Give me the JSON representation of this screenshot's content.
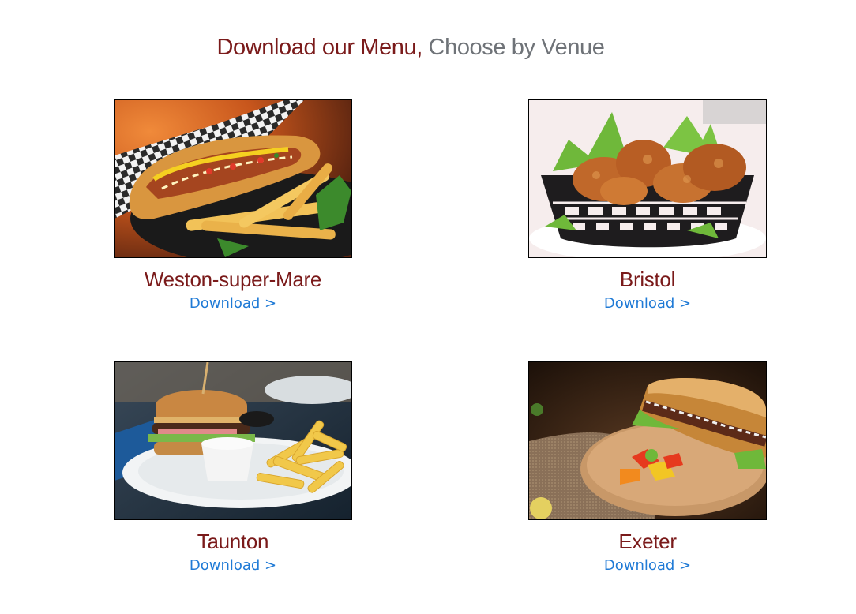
{
  "heading": {
    "part1": "Download our Menu,",
    "part2": "Choose by Venue"
  },
  "venues": [
    {
      "name": "Weston-super-Mare",
      "link": "Download >",
      "photo": "hotdog-and-fries-photo"
    },
    {
      "name": "Bristol",
      "link": "Download >",
      "photo": "fried-chicken-basket-photo"
    },
    {
      "name": "Taunton",
      "link": "Download >",
      "photo": "burger-and-fries-photo"
    },
    {
      "name": "Exeter",
      "link": "Download >",
      "photo": "sub-sandwich-photo"
    }
  ],
  "colors": {
    "heading_accent": "#7a1a1a",
    "heading_muted": "#6f7378",
    "link": "#1f7ad6"
  }
}
